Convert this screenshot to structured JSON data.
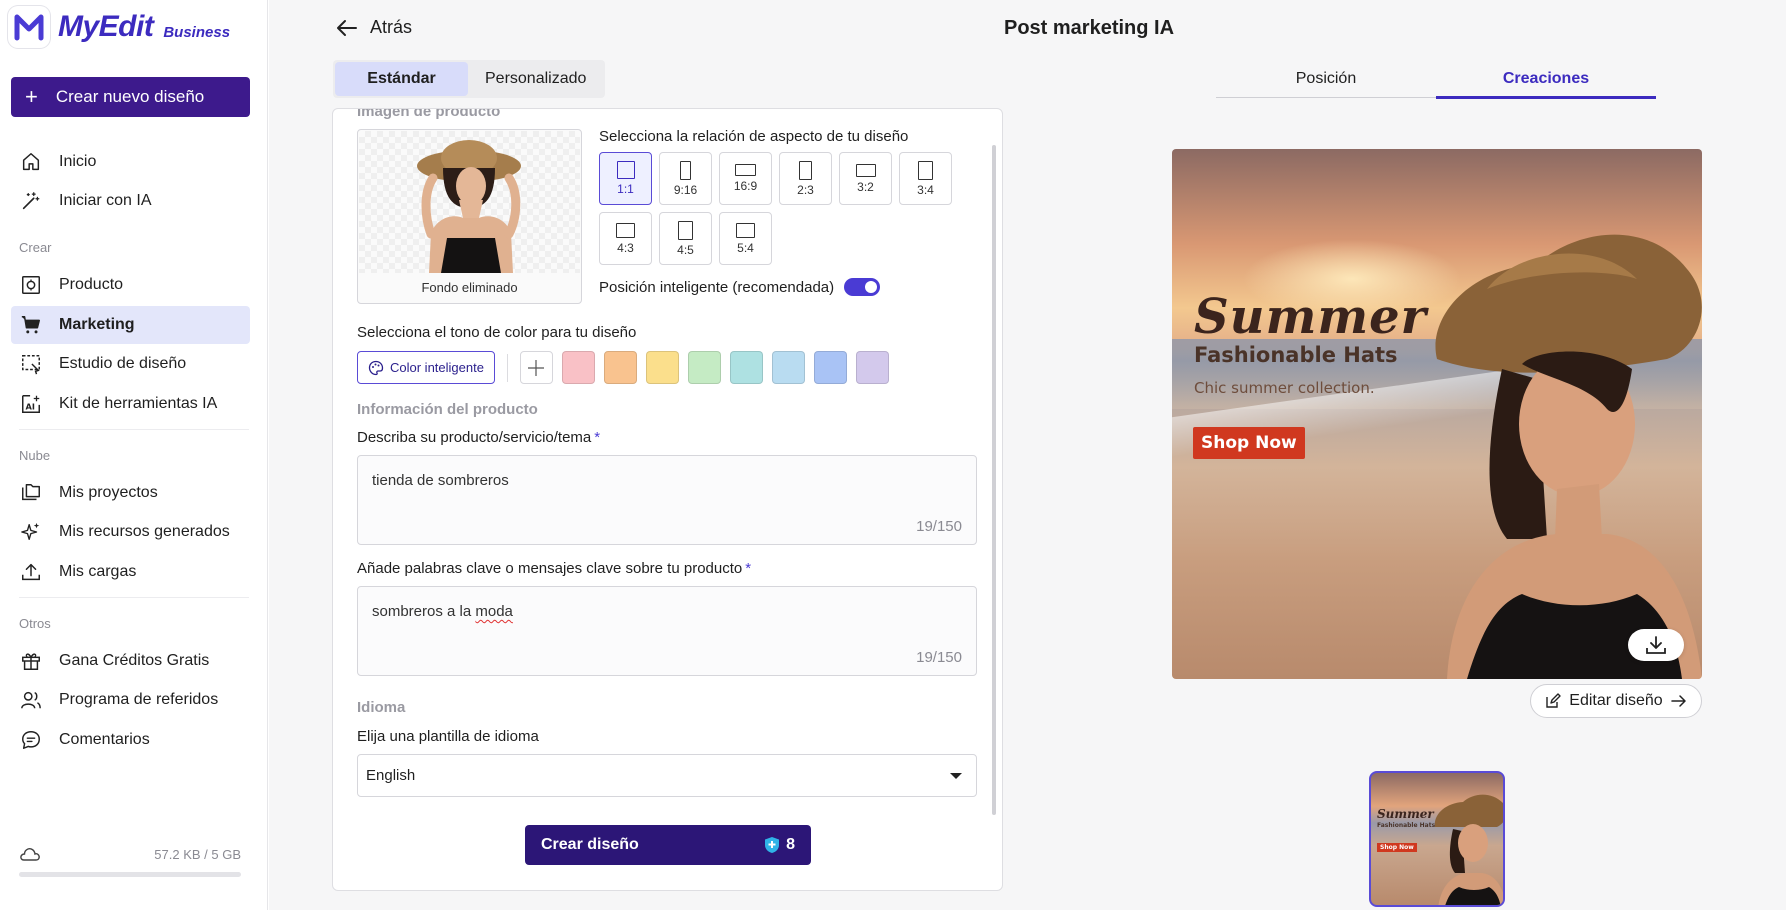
{
  "brand": {
    "name": "MyEdit",
    "tier": "Business"
  },
  "sidebar": {
    "create_button": "Crear nuevo diseño",
    "items_top": [
      {
        "label": "Inicio",
        "icon": "home-icon"
      },
      {
        "label": "Iniciar con IA",
        "icon": "magic-wand-icon"
      }
    ],
    "section_create": "Crear",
    "items_create": [
      {
        "label": "Producto",
        "icon": "product-icon"
      },
      {
        "label": "Marketing",
        "icon": "cart-icon",
        "active": true
      },
      {
        "label": "Estudio de diseño",
        "icon": "design-studio-icon"
      },
      {
        "label": "Kit de herramientas IA",
        "icon": "ai-toolkit-icon"
      }
    ],
    "section_cloud": "Nube",
    "items_cloud": [
      {
        "label": "Mis proyectos",
        "icon": "folders-icon"
      },
      {
        "label": "Mis recursos generados",
        "icon": "sparkles-icon"
      },
      {
        "label": "Mis cargas",
        "icon": "upload-icon"
      }
    ],
    "section_other": "Otros",
    "items_other": [
      {
        "label": "Gana Créditos Gratis",
        "icon": "gift-icon"
      },
      {
        "label": "Programa de referidos",
        "icon": "users-icon"
      },
      {
        "label": "Comentarios",
        "icon": "comment-icon"
      }
    ],
    "storage": {
      "text": "57.2 KB / 5 GB",
      "fraction": 0.0
    }
  },
  "header": {
    "back_label": "Atrás",
    "title": "Post marketing IA"
  },
  "mode_tabs": [
    {
      "label": "Estándar",
      "active": true
    },
    {
      "label": "Personalizado",
      "active": false
    }
  ],
  "form": {
    "product_image_label": "Imagen de producto",
    "product_image_caption": "Fondo eliminado",
    "ratio_title": "Selecciona la relación de aspecto de tu diseño",
    "ratios": [
      {
        "label": "1:1",
        "active": true
      },
      {
        "label": "9:16"
      },
      {
        "label": "16:9"
      },
      {
        "label": "2:3"
      },
      {
        "label": "3:2"
      },
      {
        "label": "3:4"
      },
      {
        "label": "4:3"
      },
      {
        "label": "4:5"
      },
      {
        "label": "5:4"
      }
    ],
    "smart_position_label": "Posición inteligente (recomendada)",
    "smart_position_on": true,
    "tone_title": "Selecciona el tono de color para tu diseño",
    "smart_color_label": "Color inteligente",
    "swatches": [
      "#f9c1c6",
      "#f9c38f",
      "#fbdf8c",
      "#c5ebc4",
      "#aee1e2",
      "#b9dcf1",
      "#a9c3f5",
      "#d3c9ec"
    ],
    "product_info_title": "Información del producto",
    "describe_label": "Describa su producto/servicio/tema",
    "describe_value": "tienda de sombreros",
    "describe_count": "19/150",
    "keywords_label": "Añade palabras clave o mensajes clave sobre tu producto",
    "keywords_value_a": "sombreros a la ",
    "keywords_value_b": "moda",
    "keywords_count": "19/150",
    "required_mark": "*",
    "language_title": "Idioma",
    "language_label": "Elija una plantilla de idioma",
    "language_value": "English",
    "submit_label": "Crear diseño",
    "submit_credits": "8"
  },
  "preview": {
    "tabs": [
      {
        "label": "Posición",
        "active": false
      },
      {
        "label": "Creaciones",
        "active": true
      }
    ],
    "headline": "Summer",
    "subheadline": "Fashionable Hats",
    "tagline": "Chic summer collection.",
    "cta": "Shop Now",
    "edit_label": "Editar diseño"
  },
  "colors": {
    "accent": "#3d1a8c",
    "brand": "#3c2bbf",
    "cta_red": "#d0381f"
  }
}
